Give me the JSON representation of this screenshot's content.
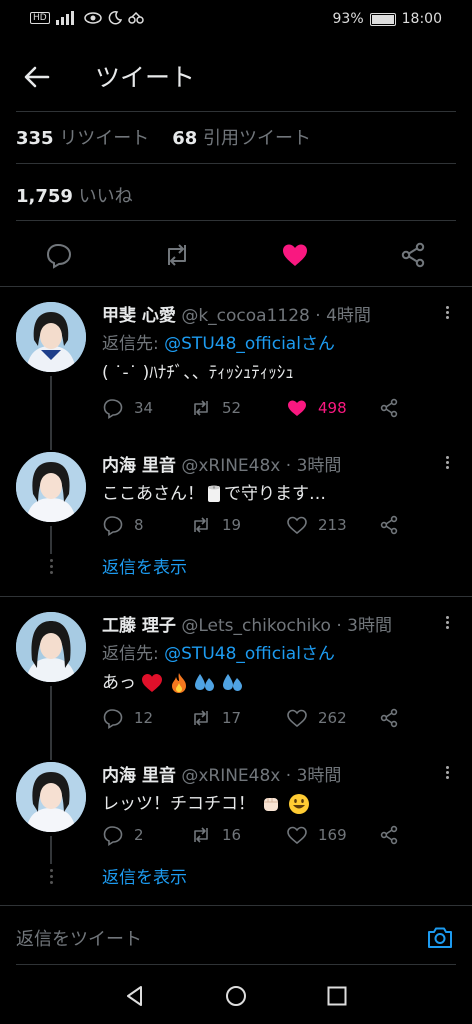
{
  "status_bar": {
    "left_text": "HD",
    "battery_percent": "93%",
    "battery_level": 0.93,
    "time": "18:00"
  },
  "header": {
    "title": "ツイート"
  },
  "stats": {
    "retweets_count": "335",
    "retweets_label": "リツイート",
    "quotes_count": "68",
    "quotes_label": "引用ツイート",
    "likes_count": "1,759",
    "likes_label": "いいね"
  },
  "action_icons": [
    "reply-icon",
    "retweet-icon",
    "like-icon",
    "share-icon"
  ],
  "colors": {
    "link": "#1d9bf0",
    "like": "#f91880",
    "muted": "#71767b"
  },
  "replies": [
    {
      "name": "甲斐 心愛",
      "handle": "@k_cocoa1128",
      "time": "· 4時間",
      "reply_prefix": "返信先: ",
      "reply_to": "@STU48_official",
      "reply_suffix": "さん",
      "text": "( ˙-˙ )ﾊﾅﾁﾞ、、ﾃｨｯｼｭﾃｨｯｼｭ",
      "replies": "34",
      "retweets": "52",
      "likes": "498",
      "liked": true
    },
    {
      "name": "内海 里音",
      "handle": "@xRINE48x",
      "time": "· 3時間",
      "text": "ここあさん！",
      "text_after": "で守ります…",
      "replies": "8",
      "retweets": "19",
      "likes": "213",
      "show_replies": "返信を表示"
    },
    {
      "name": "工藤 理子",
      "handle": "@Lets_chikochiko",
      "time": "· 3時間",
      "reply_prefix": "返信先: ",
      "reply_to": "@STU48_official",
      "reply_suffix": "さん",
      "text": "あっ",
      "replies": "12",
      "retweets": "17",
      "likes": "262"
    },
    {
      "name": "内海 里音",
      "handle": "@xRINE48x",
      "time": "· 3時間",
      "text": "レッツ！チコチコ！",
      "replies": "2",
      "retweets": "16",
      "likes": "169",
      "show_replies": "返信を表示"
    }
  ],
  "compose": {
    "placeholder": "返信をツイート"
  }
}
